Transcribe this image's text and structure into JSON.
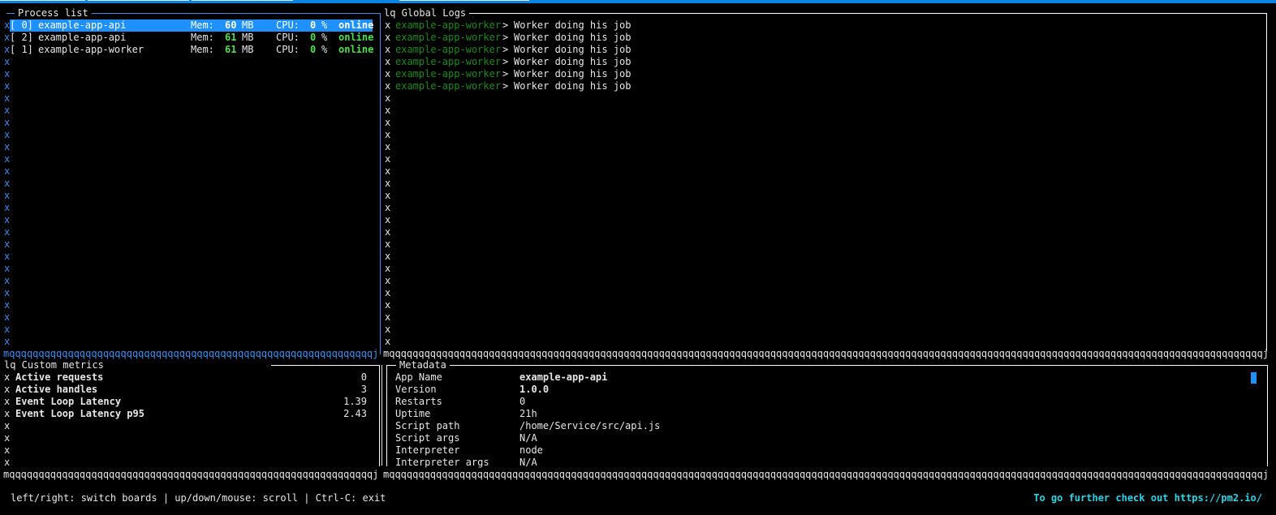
{
  "process_list": {
    "title": "Process list",
    "processes": [
      {
        "id": "[ 0]",
        "name": "example-app-api",
        "mem_label": "Mem:",
        "mem": "60",
        "mem_unit": "MB",
        "cpu_label": "CPU:",
        "cpu": "0",
        "cpu_unit": "%",
        "status": "online",
        "selected": true
      },
      {
        "id": "[ 2]",
        "name": "example-app-api",
        "mem_label": "Mem:",
        "mem": "61",
        "mem_unit": "MB",
        "cpu_label": "CPU:",
        "cpu": "0",
        "cpu_unit": "%",
        "status": "online",
        "selected": false
      },
      {
        "id": "[ 1]",
        "name": "example-app-worker",
        "mem_label": "Mem:",
        "mem": "61",
        "mem_unit": "MB",
        "cpu_label": "CPU:",
        "cpu": "0",
        "cpu_unit": "%",
        "status": "online",
        "selected": false
      }
    ],
    "gutter_char": "x"
  },
  "global_logs": {
    "title": "lq Global Logs",
    "entries": [
      {
        "app": "example-app-worker",
        "sep": ">",
        "message": "Worker doing his job"
      },
      {
        "app": "example-app-worker",
        "sep": ">",
        "message": "Worker doing his job"
      },
      {
        "app": "example-app-worker",
        "sep": ">",
        "message": "Worker doing his job"
      },
      {
        "app": "example-app-worker",
        "sep": ">",
        "message": "Worker doing his job"
      },
      {
        "app": "example-app-worker",
        "sep": ">",
        "message": "Worker doing his job"
      },
      {
        "app": "example-app-worker",
        "sep": ">",
        "message": "Worker doing his job"
      }
    ],
    "gutter_char": "x"
  },
  "custom_metrics": {
    "title": "lq Custom metrics",
    "metrics": [
      {
        "name": "Active requests",
        "value": "0"
      },
      {
        "name": "Active handles",
        "value": "3"
      },
      {
        "name": "Event Loop Latency",
        "value": "1.39"
      },
      {
        "name": "Event Loop Latency p95",
        "value": "2.43"
      }
    ],
    "gutter_char": "x"
  },
  "metadata": {
    "title": "Metadata",
    "fields": [
      {
        "key": "App Name",
        "value": "example-app-api",
        "bold": true
      },
      {
        "key": "Version",
        "value": "1.0.0",
        "bold": true
      },
      {
        "key": "Restarts",
        "value": "0",
        "bold": false
      },
      {
        "key": "Uptime",
        "value": "21h",
        "bold": false
      },
      {
        "key": "Script path",
        "value": "/home/Service/src/api.js",
        "bold": false
      },
      {
        "key": "Script args",
        "value": "N/A",
        "bold": false
      },
      {
        "key": "Interpreter",
        "value": "node",
        "bold": false
      },
      {
        "key": "Interpreter args",
        "value": "N/A",
        "bold": false
      }
    ]
  },
  "border_chars": {
    "corner_bl": "m",
    "horizontal": "q",
    "corner_br": "j"
  },
  "footer": {
    "help": "left/right: switch boards | up/down/mouse: scroll | Ctrl-C: exit",
    "link_text": "To go further check out https://pm2.io/"
  },
  "colors": {
    "accent_blue": "#3b8eea",
    "selection": "#1e90ff",
    "online_green": "#4ee04e",
    "log_app_green": "#1b8a1b",
    "link_cyan": "#29d4e6"
  }
}
